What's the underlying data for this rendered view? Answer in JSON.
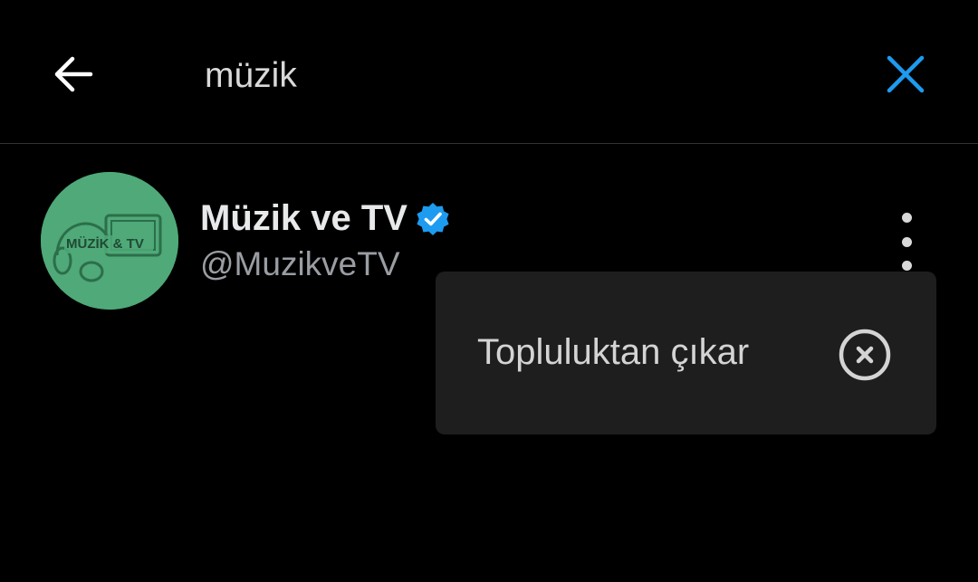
{
  "search": {
    "query": "müzik"
  },
  "result": {
    "display_name": "Müzik ve TV",
    "handle": "@MuzikveTV",
    "verified": true,
    "avatar_text": "MÜZİK & TV"
  },
  "menu": {
    "items": [
      {
        "label": "Topluluktan çıkar",
        "icon": "remove-circle-icon"
      }
    ]
  },
  "colors": {
    "background": "#000000",
    "accent": "#1d9bf0",
    "avatar_bg": "#4fa978",
    "menu_bg": "#1e1e1e",
    "divider": "#2f3336"
  },
  "icons": {
    "back": "arrow-left-icon",
    "close": "close-icon",
    "more": "more-vertical-icon",
    "verified": "verified-badge-icon"
  }
}
